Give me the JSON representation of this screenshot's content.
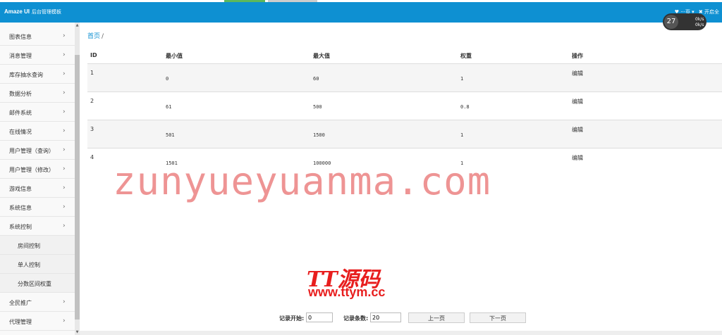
{
  "header": {
    "brand": "Amaze UI",
    "brand_sub": "后台管理模板",
    "right_items": [
      "♥ ···页 ▾",
      "✖ 开启全"
    ]
  },
  "speed_widget": {
    "percent": "27",
    "up": "0k/s",
    "down": "0k/s"
  },
  "sidebar": {
    "items": [
      {
        "label": "图表信息",
        "chevron": "›"
      },
      {
        "label": "消息管理",
        "chevron": "›"
      },
      {
        "label": "库存抽水查询",
        "chevron": "›"
      },
      {
        "label": "数据分析",
        "chevron": "›"
      },
      {
        "label": "邮件系统",
        "chevron": "›"
      },
      {
        "label": "在线情况",
        "chevron": "›"
      },
      {
        "label": "用户管理（查询）",
        "chevron": "›"
      },
      {
        "label": "用户管理（修改）",
        "chevron": "›"
      },
      {
        "label": "游戏信息",
        "chevron": "›"
      },
      {
        "label": "系统信息",
        "chevron": "›"
      },
      {
        "label": "系统控制",
        "chevron": "›"
      }
    ],
    "sub_items": [
      {
        "label": "房间控制"
      },
      {
        "label": "单人控制"
      },
      {
        "label": "分数区间权重"
      }
    ],
    "items_after": [
      {
        "label": "全民推广",
        "chevron": "›"
      },
      {
        "label": "代理管理",
        "chevron": "›"
      }
    ]
  },
  "breadcrumb": {
    "home": "首页",
    "sep": "/"
  },
  "table": {
    "columns": [
      "ID",
      "最小值",
      "最大值",
      "权重",
      "操作"
    ],
    "rows": [
      {
        "id": "1",
        "min": "0",
        "max": "60",
        "weight": "1",
        "action": "编辑"
      },
      {
        "id": "2",
        "min": "61",
        "max": "500",
        "weight": "0.8",
        "action": "编辑"
      },
      {
        "id": "3",
        "min": "501",
        "max": "1500",
        "weight": "1",
        "action": "编辑"
      },
      {
        "id": "4",
        "min": "1501",
        "max": "100000",
        "weight": "1",
        "action": "编辑"
      }
    ]
  },
  "pager": {
    "start_label": "记录开始:",
    "start_value": "0",
    "count_label": "记录条数:",
    "count_value": "20",
    "prev_label": "上一页",
    "next_label": "下一页"
  },
  "watermark": {
    "text": "zunyueyuanma.com",
    "logo_line1": "TT源码",
    "logo_line2": "www.ttym.cc"
  },
  "colors": {
    "header_bg": "#0e90d2",
    "link": "#0e90d2",
    "watermark": "#e87070"
  }
}
